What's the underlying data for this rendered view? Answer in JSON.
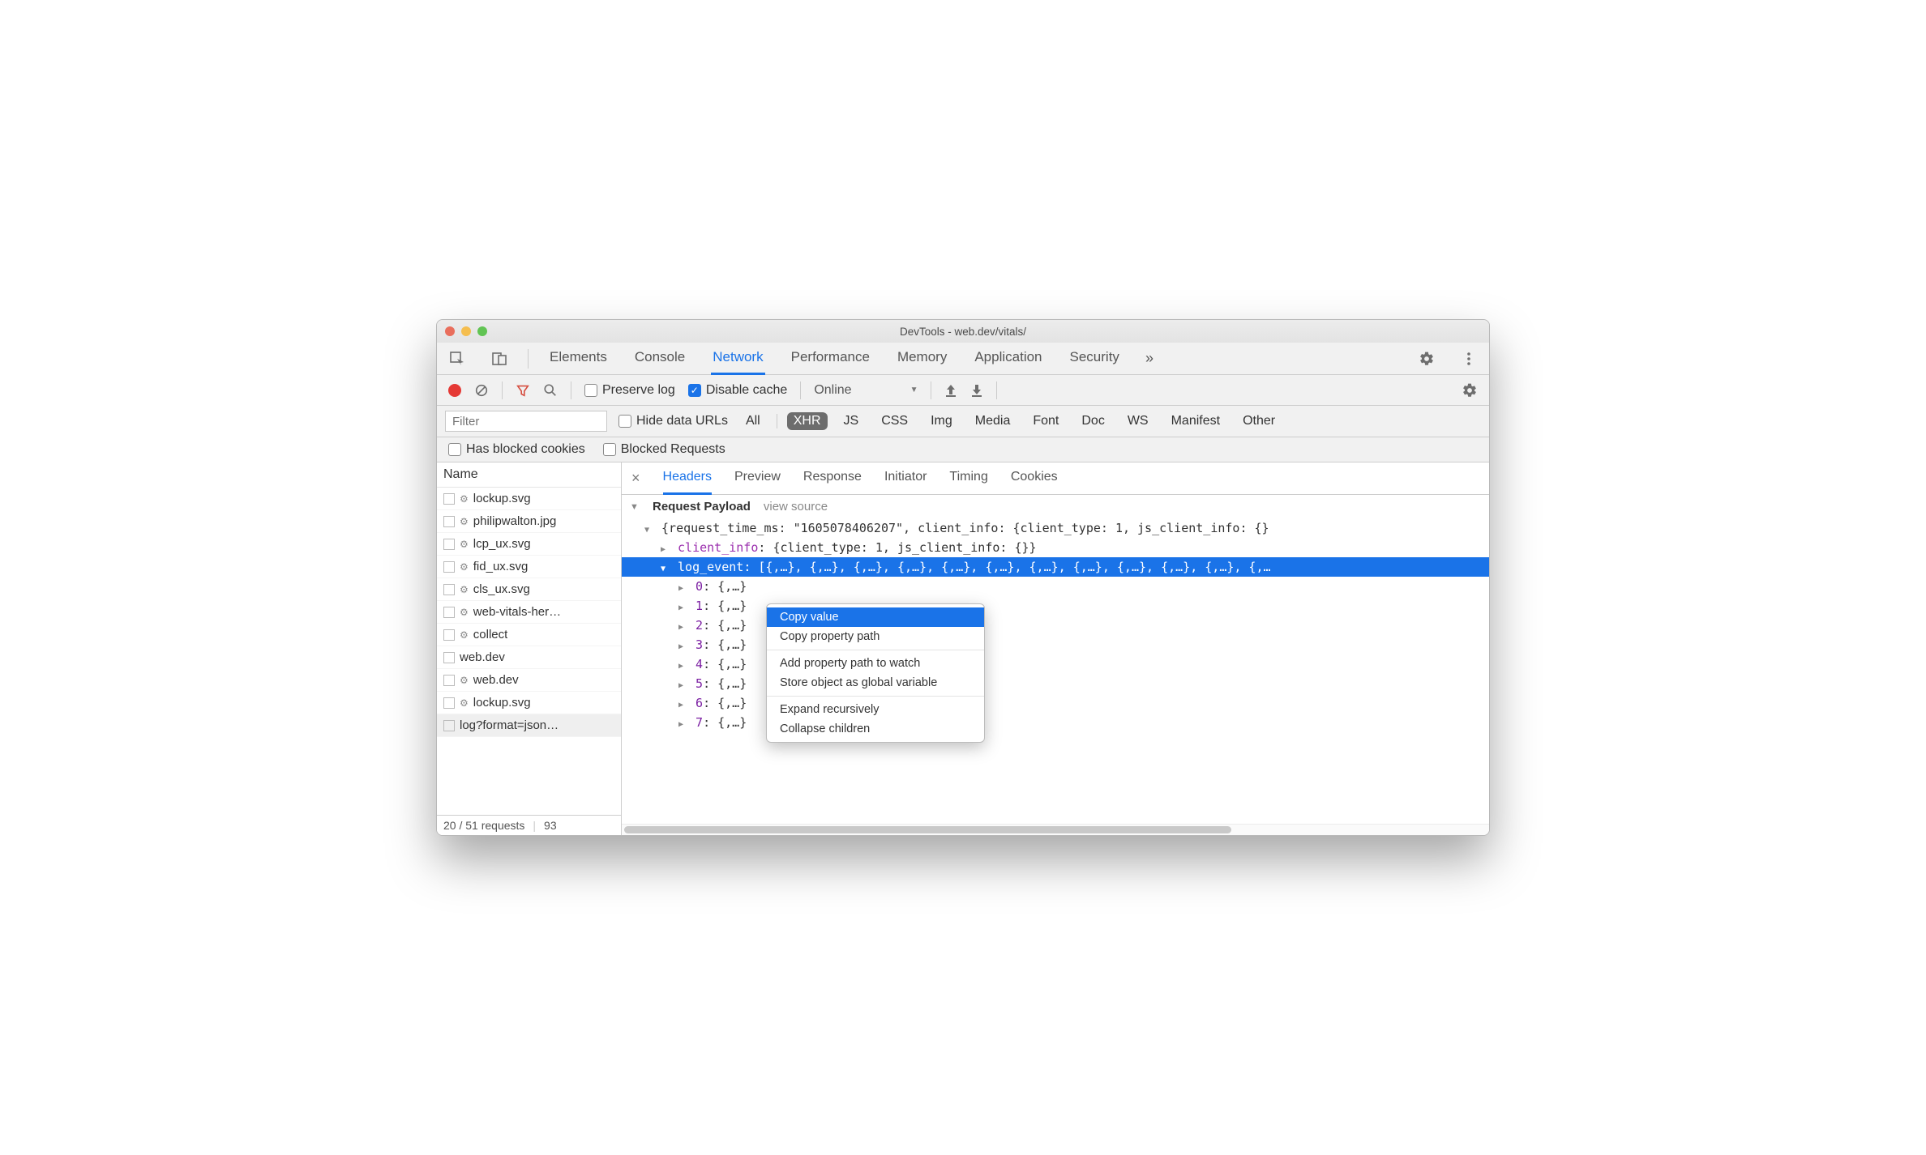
{
  "window": {
    "title": "DevTools - web.dev/vitals/"
  },
  "mainTabs": {
    "items": [
      "Elements",
      "Console",
      "Network",
      "Performance",
      "Memory",
      "Application",
      "Security"
    ],
    "active": "Network",
    "overflow": "»"
  },
  "toolbar": {
    "preserveLog": {
      "label": "Preserve log",
      "checked": false
    },
    "disableCache": {
      "label": "Disable cache",
      "checked": true
    },
    "throttling": {
      "label": "Online"
    }
  },
  "filterBar": {
    "filterPlaceholder": "Filter",
    "hideDataUrls": {
      "label": "Hide data URLs",
      "checked": false
    },
    "types": [
      "All",
      "XHR",
      "JS",
      "CSS",
      "Img",
      "Media",
      "Font",
      "Doc",
      "WS",
      "Manifest",
      "Other"
    ],
    "activeType": "XHR"
  },
  "filterBar2": {
    "hasBlockedCookies": {
      "label": "Has blocked cookies",
      "checked": false
    },
    "blockedRequests": {
      "label": "Blocked Requests",
      "checked": false
    }
  },
  "nameColumn": {
    "header": "Name",
    "rows": [
      {
        "gear": true,
        "name": "lockup.svg"
      },
      {
        "gear": true,
        "name": "philipwalton.jpg"
      },
      {
        "gear": true,
        "name": "lcp_ux.svg"
      },
      {
        "gear": true,
        "name": "fid_ux.svg"
      },
      {
        "gear": true,
        "name": "cls_ux.svg"
      },
      {
        "gear": true,
        "name": "web-vitals-her…"
      },
      {
        "gear": true,
        "name": "collect"
      },
      {
        "gear": false,
        "name": "web.dev"
      },
      {
        "gear": true,
        "name": "web.dev"
      },
      {
        "gear": true,
        "name": "lockup.svg"
      },
      {
        "gear": false,
        "name": "log?format=json…",
        "selected": true
      }
    ],
    "status": {
      "left": "20 / 51 requests",
      "right": "93"
    }
  },
  "detailTabs": {
    "items": [
      "Headers",
      "Preview",
      "Response",
      "Initiator",
      "Timing",
      "Cookies"
    ],
    "active": "Headers"
  },
  "payload": {
    "sectionTitle": "Request Payload",
    "viewSource": "view source",
    "rootLine": "{request_time_ms: \"1605078406207\", client_info: {client_type: 1, js_client_info: {}",
    "clientInfoLine": {
      "key": "client_info",
      "value": "{client_type: 1, js_client_info: {}}"
    },
    "logEventLine": {
      "key": "log_event",
      "value": "[{,…}, {,…}, {,…}, {,…}, {,…}, {,…}, {,…}, {,…}, {,…}, {,…}, {,…}, {,…"
    },
    "items": [
      {
        "idx": "0",
        "val": "{,…}"
      },
      {
        "idx": "1",
        "val": "{,…}"
      },
      {
        "idx": "2",
        "val": "{,…}"
      },
      {
        "idx": "3",
        "val": "{,…}"
      },
      {
        "idx": "4",
        "val": "{,…}"
      },
      {
        "idx": "5",
        "val": "{,…}"
      },
      {
        "idx": "6",
        "val": "{,…}"
      },
      {
        "idx": "7",
        "val": "{,…}"
      }
    ]
  },
  "contextMenu": {
    "items": [
      {
        "label": "Copy value",
        "highlighted": true
      },
      {
        "label": "Copy property path"
      },
      {
        "sep": true
      },
      {
        "label": "Add property path to watch"
      },
      {
        "label": "Store object as global variable"
      },
      {
        "sep": true
      },
      {
        "label": "Expand recursively"
      },
      {
        "label": "Collapse children"
      }
    ]
  }
}
